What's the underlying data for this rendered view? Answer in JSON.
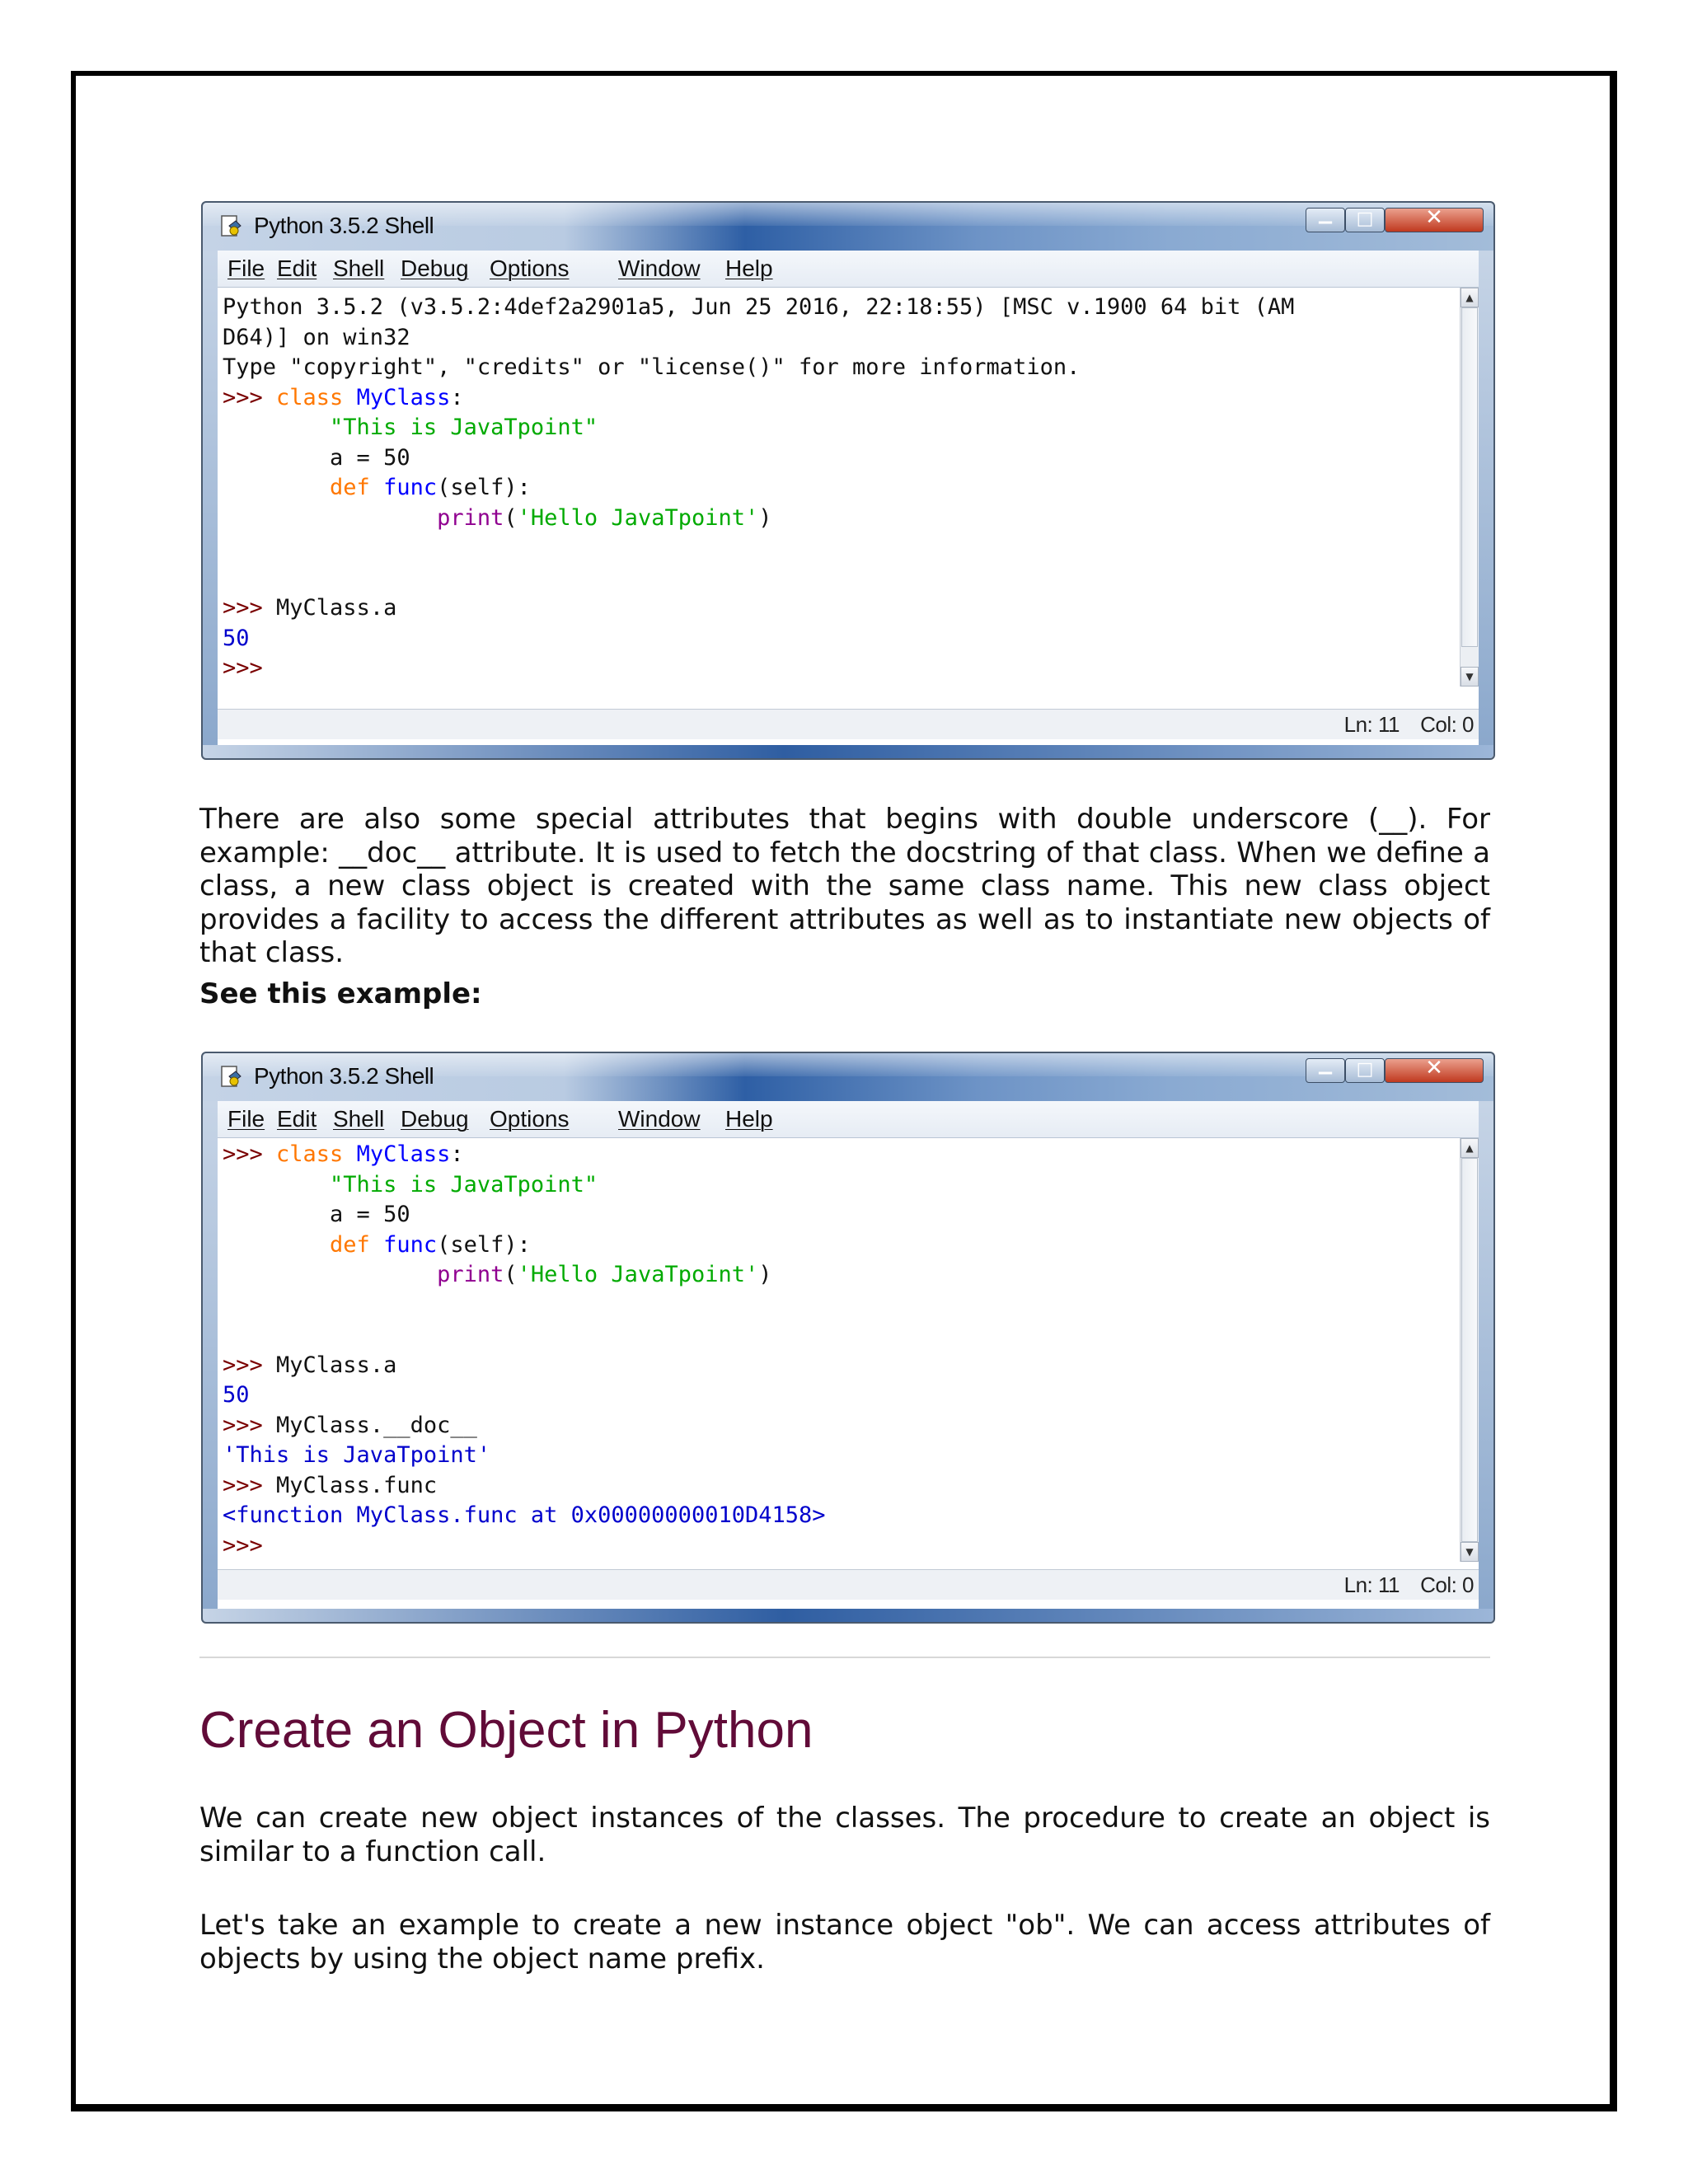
{
  "window": {
    "title": "Python 3.5.2 Shell",
    "menu": [
      "File",
      "Edit",
      "Shell",
      "Debug",
      "Options",
      "Window",
      "Help"
    ],
    "status_line": "Ln: 11",
    "status_col": "Col: 0",
    "controls": {
      "minimize": "−",
      "maximize": "□",
      "close": "✕"
    }
  },
  "shell1": {
    "banner_line1": "Python 3.5.2 (v3.5.2:4def2a2901a5, Jun 25 2016, 22:18:55) [MSC v.1900 64 bit (AM",
    "banner_line2": "D64)] on win32",
    "banner_line3": "Type \"copyright\", \"credits\" or \"license()\" for more information.",
    "prompt": ">>> ",
    "kw_class": "class",
    "class_name": " MyClass",
    "colon": ":",
    "indent1": "        ",
    "docstring": "\"This is JavaTpoint\"",
    "assign": "a = 50",
    "kw_def": "def",
    "func_name": " func",
    "params": "(self):",
    "indent2": "                ",
    "builtin_print": "print",
    "print_open": "(",
    "print_str": "'Hello JavaTpoint'",
    "print_close": ")",
    "cmd_attr": "MyClass.a",
    "out_attr": "50",
    "final_prompt": ">>>"
  },
  "shell2": {
    "cmd_doc": "MyClass.__doc__",
    "out_doc": "'This is JavaTpoint'",
    "cmd_func": "MyClass.func",
    "out_func": "<function MyClass.func at 0x00000000010D4158>"
  },
  "text": {
    "para1": "There are also some special attributes that begins with double underscore (__). For example: __doc__ attribute. It is used to fetch the docstring of that class. When we define a class, a new class object is created with the same class name. This new class object provides a facility to access the different attributes as well as to instantiate new objects of that class.",
    "see_example": "See this example:",
    "heading": "Create an Object in Python",
    "para2": "We can create new object instances of the classes. The procedure to create an object is similar to a function call.",
    "para3": "Let's take an example to create a new instance object \"ob\". We can access attributes of objects by using the object name prefix."
  }
}
